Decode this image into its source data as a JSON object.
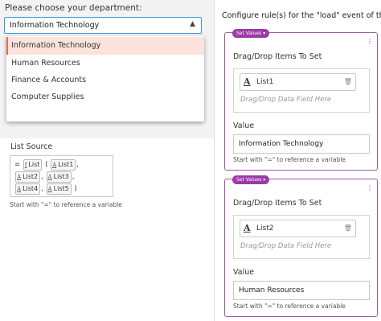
{
  "department": {
    "label": "Please choose your department:",
    "selected": "Information Technology",
    "options": [
      "Information Technology",
      "Human Resources",
      "Finance & Accounts",
      "Computer Supplies"
    ]
  },
  "list_source": {
    "label": "List Source",
    "formula_prefix": "=",
    "func_icon": "f",
    "func_name": "List",
    "open_paren": "(",
    "close_paren": ")",
    "comma": ",",
    "text_icon": "A",
    "items": [
      "List1",
      "List2",
      "List3",
      "List4",
      "List5"
    ],
    "hint": "Start with \"=\" to reference a variable"
  },
  "config": {
    "title": "Configure rule(s) for the \"load\" event of the Main",
    "cards": [
      {
        "badge": "Set Values",
        "drag_title": "Drag/Drop Items To Set",
        "item": "List1",
        "drop_hint": "Drag/Drop Data Field Here",
        "value_label": "Value",
        "value": "Information Technology",
        "hint": "Start with \"=\" to reference a variable"
      },
      {
        "badge": "Set Values",
        "drag_title": "Drag/Drop Items To Set",
        "item": "List2",
        "drop_hint": "Drag/Drop Data Field Here",
        "value_label": "Value",
        "value": "Human Resources",
        "hint": "Start with \"=\" to reference a variable"
      }
    ]
  },
  "colors": {
    "accent_blue": "#3a9ad9",
    "selected_bg": "#fbe3dc",
    "selected_bar": "#e26c55",
    "card_border": "#9b5ca8",
    "badge_bg": "#9b3aa7"
  },
  "icons": {
    "select_chevron": "chevron-up-icon",
    "func": "function-icon",
    "text_field": "text-field-icon",
    "card_menu": "more-vertical-icon",
    "remove": "trash-icon"
  }
}
